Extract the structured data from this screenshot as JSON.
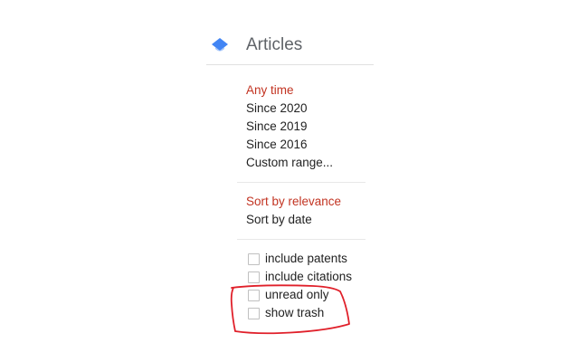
{
  "header": {
    "title": "Articles",
    "logo_color": "#4285f4"
  },
  "time_filter": {
    "items": [
      {
        "label": "Any time",
        "selected": true
      },
      {
        "label": "Since 2020",
        "selected": false
      },
      {
        "label": "Since 2019",
        "selected": false
      },
      {
        "label": "Since 2016",
        "selected": false
      },
      {
        "label": "Custom range...",
        "selected": false
      }
    ]
  },
  "sort": {
    "items": [
      {
        "label": "Sort by relevance",
        "selected": true
      },
      {
        "label": "Sort by date",
        "selected": false
      }
    ]
  },
  "checkboxes": [
    {
      "label": "include patents",
      "checked": false
    },
    {
      "label": "include citations",
      "checked": false
    },
    {
      "label": "unread only",
      "checked": false
    },
    {
      "label": "show trash",
      "checked": false
    }
  ],
  "colors": {
    "active_text": "#c23321",
    "annotation": "#e0202a"
  }
}
